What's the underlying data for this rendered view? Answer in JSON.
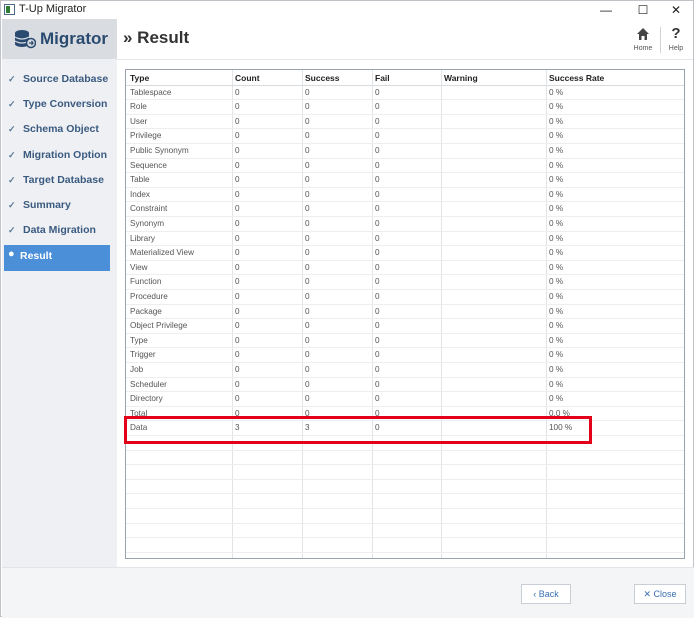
{
  "window": {
    "title": "T-Up Migrator",
    "minimize": "—",
    "maximize": "☐",
    "close": "✕"
  },
  "sidebar": {
    "logo_text": "Migrator",
    "items": [
      {
        "label": "Source Database",
        "marker": "✓",
        "active": false
      },
      {
        "label": "Type Conversion",
        "marker": "✓",
        "active": false
      },
      {
        "label": "Schema Object",
        "marker": "✓",
        "active": false
      },
      {
        "label": "Migration Option",
        "marker": "✓",
        "active": false
      },
      {
        "label": "Target Database",
        "marker": "✓",
        "active": false
      },
      {
        "label": "Summary",
        "marker": "✓",
        "active": false
      },
      {
        "label": "Data Migration",
        "marker": "✓",
        "active": false
      },
      {
        "label": "Result",
        "marker": "●",
        "active": true
      }
    ]
  },
  "header": {
    "title": "» Result",
    "home_label": "Home",
    "help_label": "Help",
    "help_glyph": "?"
  },
  "table": {
    "columns": [
      "Type",
      "Count",
      "Success",
      "Fail",
      "Warning",
      "Success Rate"
    ],
    "rows": [
      [
        "Tablespace",
        "0",
        "0",
        "0",
        "",
        "0 %"
      ],
      [
        "Role",
        "0",
        "0",
        "0",
        "",
        "0 %"
      ],
      [
        "User",
        "0",
        "0",
        "0",
        "",
        "0 %"
      ],
      [
        "Privilege",
        "0",
        "0",
        "0",
        "",
        "0 %"
      ],
      [
        "Public Synonym",
        "0",
        "0",
        "0",
        "",
        "0 %"
      ],
      [
        "Sequence",
        "0",
        "0",
        "0",
        "",
        "0 %"
      ],
      [
        "Table",
        "0",
        "0",
        "0",
        "",
        "0 %"
      ],
      [
        "Index",
        "0",
        "0",
        "0",
        "",
        "0 %"
      ],
      [
        "Constraint",
        "0",
        "0",
        "0",
        "",
        "0 %"
      ],
      [
        "Synonym",
        "0",
        "0",
        "0",
        "",
        "0 %"
      ],
      [
        "Library",
        "0",
        "0",
        "0",
        "",
        "0 %"
      ],
      [
        "Materialized View",
        "0",
        "0",
        "0",
        "",
        "0 %"
      ],
      [
        "View",
        "0",
        "0",
        "0",
        "",
        "0 %"
      ],
      [
        "Function",
        "0",
        "0",
        "0",
        "",
        "0 %"
      ],
      [
        "Procedure",
        "0",
        "0",
        "0",
        "",
        "0 %"
      ],
      [
        "Package",
        "0",
        "0",
        "0",
        "",
        "0 %"
      ],
      [
        "Object Privilege",
        "0",
        "0",
        "0",
        "",
        "0 %"
      ],
      [
        "Type",
        "0",
        "0",
        "0",
        "",
        "0 %"
      ],
      [
        "Trigger",
        "0",
        "0",
        "0",
        "",
        "0 %"
      ],
      [
        "Job",
        "0",
        "0",
        "0",
        "",
        "0 %"
      ],
      [
        "Scheduler",
        "0",
        "0",
        "0",
        "",
        "0 %"
      ],
      [
        "Directory",
        "0",
        "0",
        "0",
        "",
        "0 %"
      ],
      [
        "Total",
        "0",
        "0",
        "0",
        "",
        "0.0 %"
      ],
      [
        "Data",
        "3",
        "3",
        "0",
        "",
        "100 %"
      ]
    ]
  },
  "footer": {
    "back_label": "‹ Back",
    "close_label": "✕ Close"
  },
  "colors": {
    "accent": "#4a8fd8",
    "highlight": "#e3001b",
    "brand": "#2b4a6f"
  }
}
